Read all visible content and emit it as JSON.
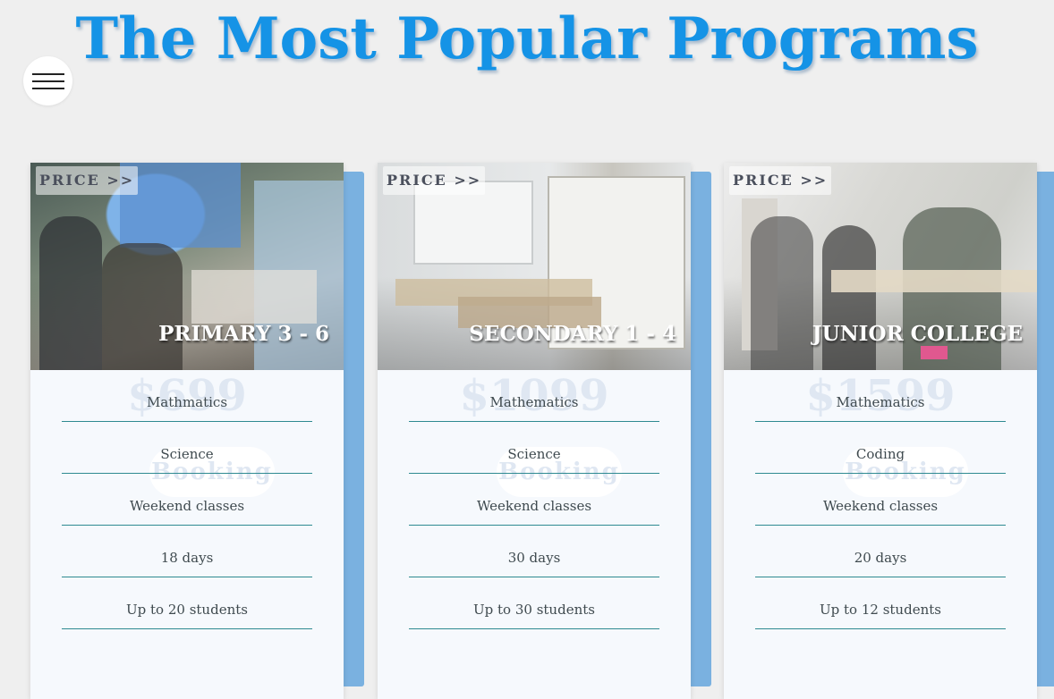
{
  "header": {
    "title": "The Most Popular Programs"
  },
  "programs": [
    {
      "price_tag": "PRICE >>",
      "level": "PRIMARY 3 - 6",
      "price": "$699",
      "button_label": "Booking",
      "features": [
        "Mathmatics",
        "Science",
        "Weekend classes",
        "18 days",
        "Up to 20 students"
      ]
    },
    {
      "price_tag": "PRICE >>",
      "level": "SECONDARY 1 - 4",
      "price": "$1099",
      "button_label": "Booking",
      "features": [
        "Mathematics",
        "Science",
        "Weekend classes",
        "30 days",
        "Up to 30 students"
      ]
    },
    {
      "price_tag": "PRICE >>",
      "level": "JUNIOR COLLEGE",
      "price": "$1599",
      "button_label": "Booking",
      "features": [
        "Mathematics",
        "Coding",
        "Weekend classes",
        "20 days",
        "Up to 12 students"
      ]
    }
  ],
  "icons": {
    "menu": "hamburger-menu-icon"
  },
  "colors": {
    "title": "#1593e6",
    "card_accent": "#7ab1e0",
    "divider": "#2e8a91"
  }
}
